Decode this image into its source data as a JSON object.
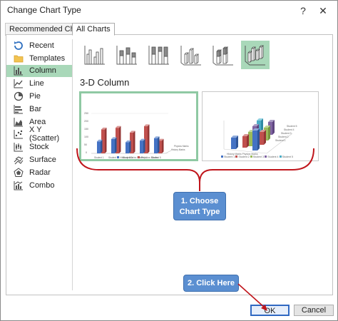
{
  "window": {
    "title": "Change Chart Type",
    "help_label": "?",
    "close_label": "✕"
  },
  "tabs": [
    {
      "label": "Recommended Charts",
      "active": false
    },
    {
      "label": "All Charts",
      "active": true
    }
  ],
  "sidebar": {
    "items": [
      {
        "label": "Recent",
        "icon": "recent-icon"
      },
      {
        "label": "Templates",
        "icon": "folder-icon"
      },
      {
        "label": "Column",
        "icon": "column-chart-icon",
        "selected": true
      },
      {
        "label": "Line",
        "icon": "line-chart-icon"
      },
      {
        "label": "Pie",
        "icon": "pie-chart-icon"
      },
      {
        "label": "Bar",
        "icon": "bar-chart-icon"
      },
      {
        "label": "Area",
        "icon": "area-chart-icon"
      },
      {
        "label": "X Y (Scatter)",
        "icon": "scatter-chart-icon"
      },
      {
        "label": "Stock",
        "icon": "stock-chart-icon"
      },
      {
        "label": "Surface",
        "icon": "surface-chart-icon"
      },
      {
        "label": "Radar",
        "icon": "radar-chart-icon"
      },
      {
        "label": "Combo",
        "icon": "combo-chart-icon"
      }
    ]
  },
  "subtypes": [
    {
      "name": "clustered-column-icon"
    },
    {
      "name": "stacked-column-icon"
    },
    {
      "name": "100-stacked-column-icon"
    },
    {
      "name": "3d-clustered-column-icon"
    },
    {
      "name": "3d-stacked-column-icon"
    },
    {
      "name": "3d-column-icon",
      "selected": true
    }
  ],
  "main": {
    "section_title": "3-D Column"
  },
  "preview_left": {
    "y_ticks": [
      "250",
      "200",
      "150",
      "100",
      "50",
      "0"
    ],
    "categories": [
      "Student 1",
      "Student 2",
      "Student 3",
      "Student 4",
      "Student 5"
    ],
    "series_labels": [
      "Physics Marks",
      "History Marks"
    ],
    "legend": [
      "History Marks",
      "Physics Marks"
    ],
    "history_values": [
      75,
      90,
      70,
      80,
      95
    ],
    "physics_values": [
      150,
      160,
      130,
      170,
      80
    ]
  },
  "preview_right": {
    "depth_labels": [
      "Student 5",
      "Student 4",
      "Student 3",
      "Student 2",
      "Student 1"
    ],
    "axis_label": "History Marks Physics Marks",
    "legend": [
      "Student 1",
      "Student 2",
      "Student 3",
      "Student 4",
      "Student 5"
    ],
    "legend_colors": [
      "#4472c4",
      "#c0504d",
      "#9bbb59",
      "#8064a2",
      "#4bacc6"
    ]
  },
  "annotations": {
    "step1_label": "1. Choose Chart Type",
    "step2_label": "2. Click Here"
  },
  "footer": {
    "ok_label": "OK",
    "cancel_label": "Cancel"
  },
  "colors": {
    "selection": "#a9d8b9",
    "callout": "#5b8fd1",
    "annotation_red": "#c0161c",
    "primary_border": "#2f68c2"
  }
}
